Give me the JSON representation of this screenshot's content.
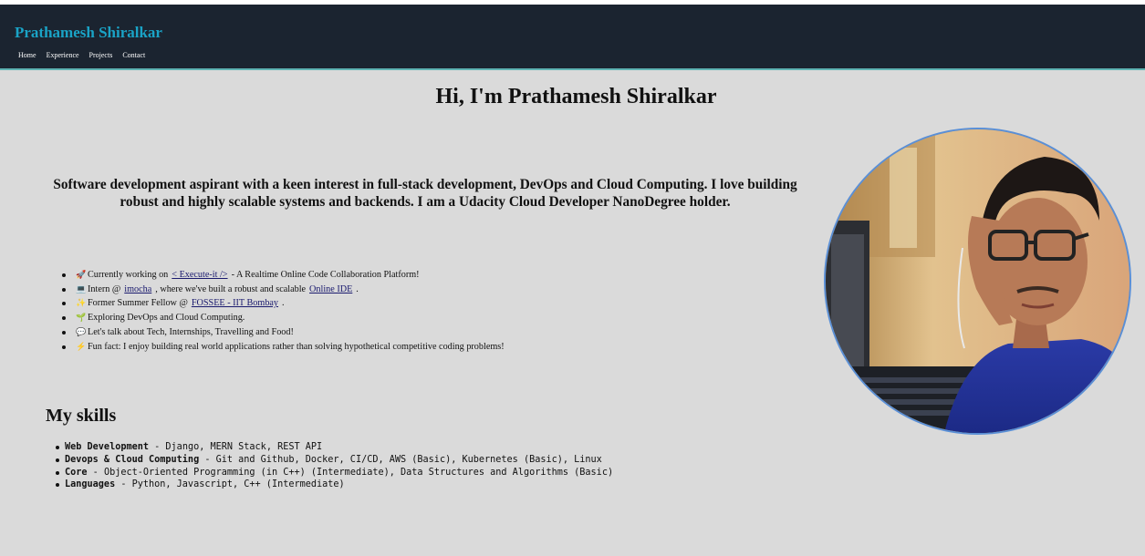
{
  "header": {
    "brand": "Prathamesh Shiralkar",
    "nav": [
      "Home",
      "Experience",
      "Projects",
      "Contact"
    ]
  },
  "hero": {
    "title": "Hi, I'm Prathamesh Shiralkar",
    "tagline": "Software development aspirant with a keen interest in full-stack development, DevOps and Cloud Computing. I love building robust and highly scalable systems and backends. I am a Udacity Cloud Developer NanoDegree holder."
  },
  "facts": [
    {
      "icon": "🚀",
      "before": "Currently working on",
      "link": "< Execute-it />",
      "after": "- A Realtime Online Code Collaboration Platform!"
    },
    {
      "icon": "💻",
      "before": "Intern @",
      "link": "imocha",
      "after": ", where we've built a robust and scalable",
      "link2": "Online IDE",
      "after2": "."
    },
    {
      "icon": "✨",
      "before": "Former Summer Fellow @",
      "link": "FOSSEE - IIT Bombay",
      "after": "."
    },
    {
      "icon": "🌱",
      "before": "Exploring DevOps and Cloud Computing.",
      "link": "",
      "after": ""
    },
    {
      "icon": "💬",
      "before": "Let's talk about Tech, Internships, Travelling and Food!",
      "link": "",
      "after": ""
    },
    {
      "icon": "⚡",
      "before": "Fun fact: I enjoy building real world applications rather than solving hypothetical competitive coding problems!",
      "link": "",
      "after": ""
    }
  ],
  "skills": {
    "title": "My skills",
    "items": [
      {
        "name": "Web Development",
        "detail": " - Django, MERN Stack, REST API"
      },
      {
        "name": "Devops & Cloud Computing",
        "detail": " - Git and Github, Docker, CI/CD, AWS (Basic), Kubernetes (Basic), Linux"
      },
      {
        "name": "Core",
        "detail": " - Object-Oriented Programming (in C++) (Intermediate), Data Structures and Algorithms (Basic)"
      },
      {
        "name": "Languages",
        "detail": " - Python, Javascript, C++ (Intermediate)"
      }
    ]
  },
  "colors": {
    "header_bg": "#1b2430",
    "brand": "#1aa3c6",
    "page_bg": "#dadada",
    "avatar_border": "#5a8fd6"
  }
}
